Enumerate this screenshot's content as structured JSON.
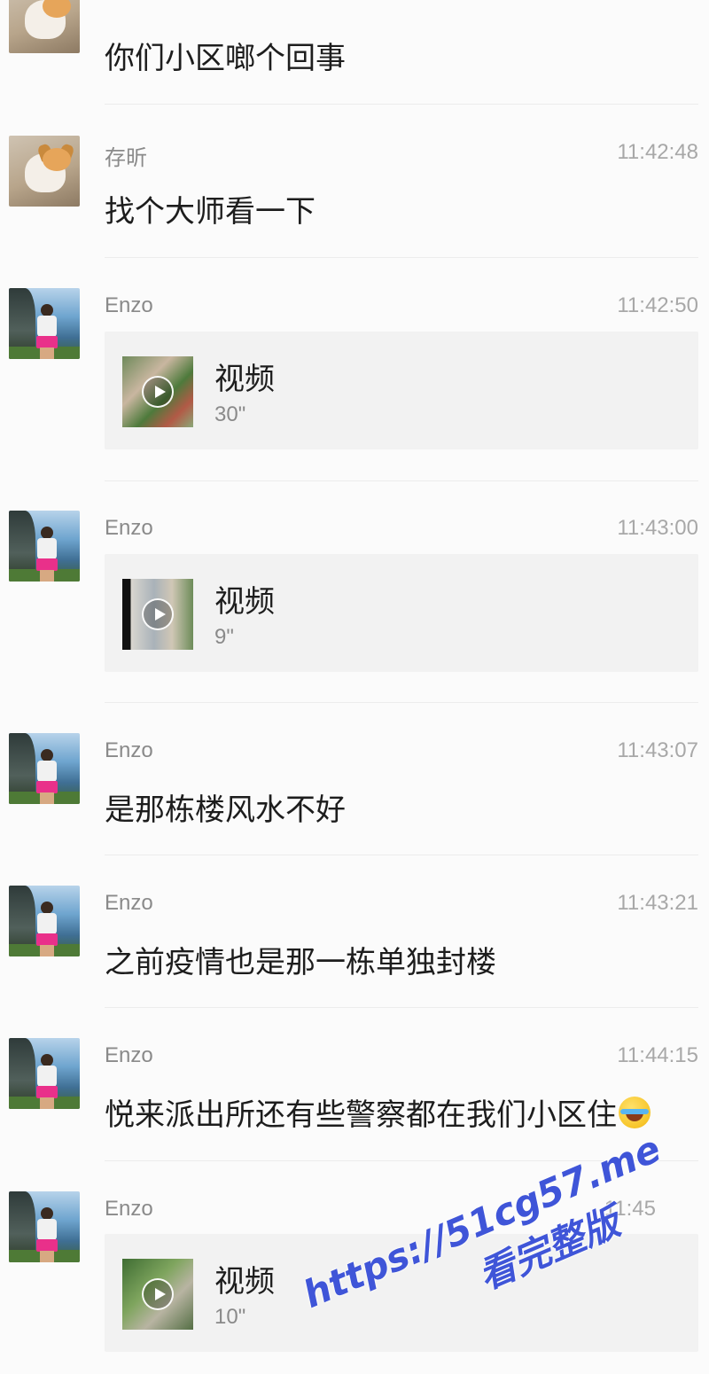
{
  "messages": [
    {
      "id": 0,
      "avatar": "dog",
      "sender": "",
      "time": "",
      "type": "text",
      "text": "你们小区啷个回事"
    },
    {
      "id": 1,
      "avatar": "dog",
      "sender": "存昕",
      "time": "11:42:48",
      "type": "text",
      "text": "找个大师看一下"
    },
    {
      "id": 2,
      "avatar": "enzo",
      "sender": "Enzo",
      "time": "11:42:50",
      "type": "video",
      "video_title": "视频",
      "duration": "30\""
    },
    {
      "id": 3,
      "avatar": "enzo",
      "sender": "Enzo",
      "time": "11:43:00",
      "type": "video",
      "video_title": "视频",
      "duration": "9\""
    },
    {
      "id": 4,
      "avatar": "enzo",
      "sender": "Enzo",
      "time": "11:43:07",
      "type": "text",
      "text": "是那栋楼风水不好"
    },
    {
      "id": 5,
      "avatar": "enzo",
      "sender": "Enzo",
      "time": "11:43:21",
      "type": "text",
      "text": "之前疫情也是那一栋单独封楼"
    },
    {
      "id": 6,
      "avatar": "enzo",
      "sender": "Enzo",
      "time": "11:44:15",
      "type": "text",
      "text": "悦来派出所还有些警察都在我们小区住",
      "emoji": "laughing-crying-emoji-icon"
    },
    {
      "id": 7,
      "avatar": "enzo",
      "sender": "Enzo",
      "time": "11:45",
      "type": "video",
      "video_title": "视频",
      "duration": "10\""
    }
  ],
  "watermark": {
    "url": "https://51cg57.me",
    "subtitle": "看完整版"
  },
  "colors": {
    "background": "#fbfbfb",
    "card": "#f2f2f2",
    "watermark": "#3f55d8"
  }
}
